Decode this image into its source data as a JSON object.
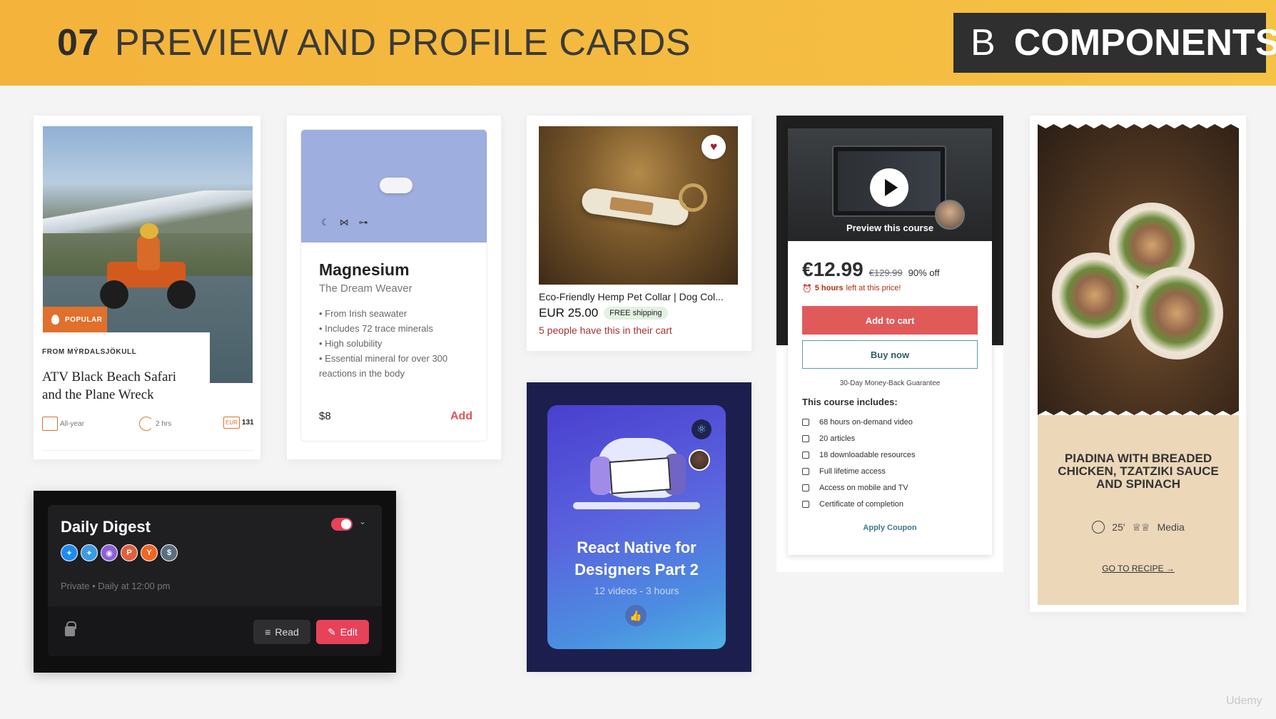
{
  "header": {
    "number": "07",
    "title": "PREVIEW AND PROFILE CARDS",
    "badge_letter": "B",
    "badge_text": "COMPONENTS"
  },
  "atv_card": {
    "badge": "POPULAR",
    "from": "FROM MÝRDALSJÖKULL",
    "title": "ATV Black Beach Safari and the Plane Wreck",
    "season": "All-year",
    "duration": "2 hrs",
    "currency": "EUR",
    "price": "131",
    "icons": [
      "calendar-icon",
      "clock-icon",
      "currency-icon"
    ],
    "accent": "#e0702c"
  },
  "magnesium_card": {
    "name": "Magnesium",
    "subtitle": "The Dream Weaver",
    "features": [
      "From Irish seawater",
      "Includes 72 trace minerals",
      "High solubility",
      "Essential mineral for over 300 reactions in the body"
    ],
    "price": "$8",
    "add_label": "Add",
    "icons": [
      "moon-icon",
      "bone-icon",
      "dumbbell-icon"
    ],
    "accent": "#e35454"
  },
  "collar_card": {
    "name": "Eco-Friendly Hemp Pet Collar | Dog Col...",
    "price": "EUR 25.00",
    "shipping": "FREE shipping",
    "people": "5 people have this in their cart"
  },
  "course_card": {
    "preview_label": "Preview this course",
    "price": "€12.99",
    "old_price": "€129.99",
    "discount": "90% off",
    "timer_bold": "5 hours",
    "timer_rest": "left at this price!",
    "add_to_cart": "Add to cart",
    "buy_now": "Buy now",
    "guarantee": "30-Day Money-Back Guarantee",
    "includes_title": "This course includes:",
    "includes": [
      "68 hours on-demand video",
      "20 articles",
      "18 downloadable resources",
      "Full lifetime access",
      "Access on mobile and TV",
      "Certificate of completion"
    ],
    "coupon": "Apply Coupon"
  },
  "piadina_card": {
    "title": "PIADINA WITH BREADED CHICKEN, TZATZIKI SAUCE AND SPINACH",
    "time": "25'",
    "difficulty": "Media",
    "link": "GO TO RECIPE →"
  },
  "digest_card": {
    "title": "Daily Digest",
    "sources": [
      {
        "icon": "bluesky-icon",
        "color": "#1d8cf0",
        "glyph": "✦"
      },
      {
        "icon": "twitter-icon",
        "color": "#3a9be8",
        "glyph": "✦"
      },
      {
        "icon": "rss-icon",
        "color": "#8f5fd8",
        "glyph": "◉"
      },
      {
        "icon": "producthunt-icon",
        "color": "#e0603a",
        "glyph": "P"
      },
      {
        "icon": "hackernews-icon",
        "color": "#f26522",
        "glyph": "Y"
      },
      {
        "icon": "dollar-icon",
        "color": "#5a6f7f",
        "glyph": "$"
      }
    ],
    "schedule": "Private • Daily at 12:00 pm",
    "read_label": "Read",
    "edit_label": "Edit",
    "toggle_on": true
  },
  "react_card": {
    "title": "React Native for Designers Part 2",
    "subtitle": "12 videos - 3 hours"
  },
  "watermark": "Udemy"
}
